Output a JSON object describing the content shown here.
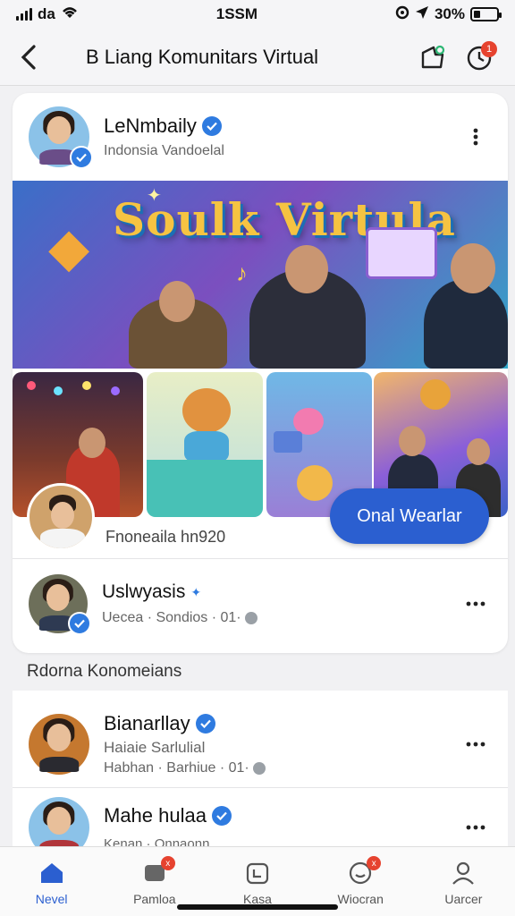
{
  "status": {
    "carrier": "da",
    "time": "1SSM",
    "battery": "30%",
    "battery_level": 0.3
  },
  "header": {
    "title": "B Liang Komunitars Virtual",
    "back_label": "back",
    "notif_count": "1"
  },
  "post": {
    "author_name": "LeNmbaily",
    "author_sub": "Indonsia Vandoelal",
    "hero_title": "Soulk Virtula",
    "follow_label": "Onal Wearlar",
    "caption": "Fnoneaila hn920"
  },
  "comment": {
    "name": "Uslwyasis",
    "meta": "Uecea · Sondios · 01·"
  },
  "section_label": "Rdorna Konomeians",
  "members": [
    {
      "name": "Bianarllay",
      "sub": "Haiaie Sarlulial",
      "meta": "Habhan · Barhiue · 01·"
    },
    {
      "name": "Mahe hulaa",
      "sub": "Kenan · Onnaonn"
    }
  ],
  "tabs": [
    {
      "label": "Nevel",
      "icon": "home-icon",
      "badge": ""
    },
    {
      "label": "Pamloa",
      "icon": "chat-icon",
      "badge": "x"
    },
    {
      "label": "Kasa",
      "icon": "calendar-icon",
      "badge": ""
    },
    {
      "label": "Wiocran",
      "icon": "bell-icon",
      "badge": "x"
    },
    {
      "label": "Uarcer",
      "icon": "profile-icon",
      "badge": ""
    }
  ],
  "colors": {
    "accent": "#2b5fd0",
    "verified": "#2f7be0",
    "badge": "#e6432f"
  }
}
